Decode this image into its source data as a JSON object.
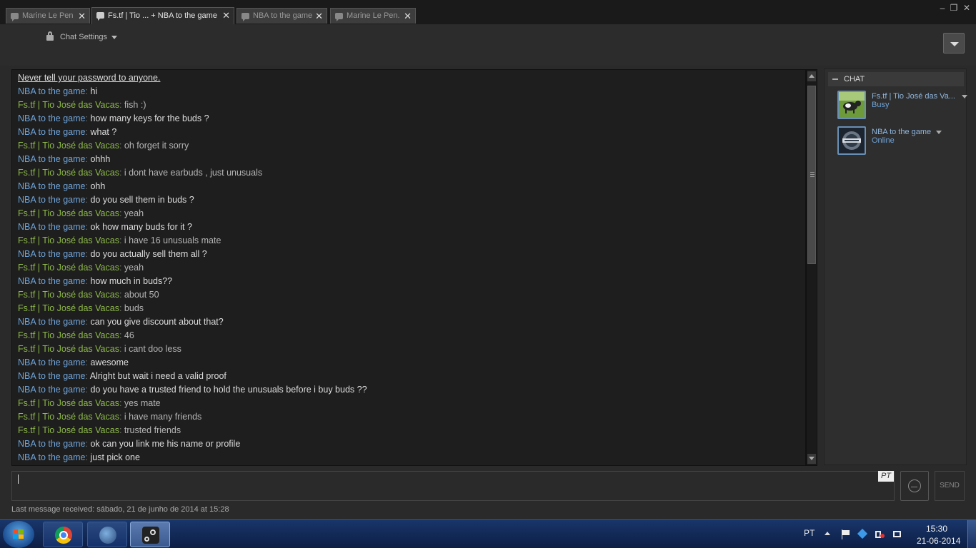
{
  "tabs": [
    {
      "label": "Marine Le Pen",
      "close": "✕"
    },
    {
      "label": "Fs.tf | Tio ... + NBA to the game",
      "close": "✕"
    },
    {
      "label": "NBA to the game",
      "close": "✕"
    },
    {
      "label": "Marine Le Pen.",
      "close": "✕"
    }
  ],
  "window_controls": {
    "minimize": "‒",
    "maximize": "❐",
    "close": "✕"
  },
  "header": {
    "chat_settings": "Chat Settings"
  },
  "chat": {
    "warning": "Never tell your password to anyone.",
    "messages": [
      {
        "sender": "NBA to the game",
        "text": "hi"
      },
      {
        "sender": "Fs.tf | Tio José das Vacas",
        "text": "fish :)"
      },
      {
        "sender": "NBA to the game",
        "text": "how many keys for the buds ?"
      },
      {
        "sender": "NBA to the game",
        "text": "what ?"
      },
      {
        "sender": "Fs.tf | Tio José das Vacas",
        "text": "oh forget it sorry"
      },
      {
        "sender": "NBA to the game",
        "text": "ohhh"
      },
      {
        "sender": "Fs.tf | Tio José das Vacas",
        "text": "i dont have earbuds , just unusuals"
      },
      {
        "sender": "NBA to the game",
        "text": "ohh"
      },
      {
        "sender": "NBA to the game",
        "text": "do you sell them in buds ?"
      },
      {
        "sender": "Fs.tf | Tio José das Vacas",
        "text": "yeah"
      },
      {
        "sender": "NBA to the game",
        "text": "ok how many buds for it ?"
      },
      {
        "sender": "Fs.tf | Tio José das Vacas",
        "text": "i have 16 unusuals mate"
      },
      {
        "sender": "NBA to the game",
        "text": "do you actually sell them all ?"
      },
      {
        "sender": "Fs.tf | Tio José das Vacas",
        "text": "yeah"
      },
      {
        "sender": "NBA to the game",
        "text": "how much in buds??"
      },
      {
        "sender": "Fs.tf | Tio José das Vacas",
        "text": "about 50"
      },
      {
        "sender": "Fs.tf | Tio José das Vacas",
        "text": "buds"
      },
      {
        "sender": "NBA to the game",
        "text": "can you give discount about that?"
      },
      {
        "sender": "Fs.tf | Tio José das Vacas",
        "text": "46"
      },
      {
        "sender": "Fs.tf | Tio José das Vacas",
        "text": "i cant doo less"
      },
      {
        "sender": "NBA to the game",
        "text": "awesome"
      },
      {
        "sender": "NBA to the game",
        "text": "Alright but wait i need a valid proof"
      },
      {
        "sender": "NBA to the game",
        "text": "do you have a trusted friend to hold the unusuals before i buy buds ??"
      },
      {
        "sender": "Fs.tf | Tio José das Vacas",
        "text": "yes mate"
      },
      {
        "sender": "Fs.tf | Tio José das Vacas",
        "text": "i have many friends"
      },
      {
        "sender": "Fs.tf | Tio José das Vacas",
        "text": "trusted friends"
      },
      {
        "sender": "NBA to the game",
        "text": "ok can you  link me his name or profile"
      },
      {
        "sender": "NBA to the game",
        "text": "just pick one"
      }
    ]
  },
  "members": {
    "section_title": "CHAT",
    "list": [
      {
        "name": "Fs.tf | Tio José das Va...",
        "status": "Busy"
      },
      {
        "name": "NBA to the game",
        "status": "Online"
      }
    ]
  },
  "input": {
    "lang_badge": "PT",
    "send_label": "SEND"
  },
  "footer": {
    "last_message": "Last message received: sábado, 21 de junho de 2014 at 15:28"
  },
  "taskbar": {
    "lang": "PT",
    "time": "15:30",
    "date": "21-06-2014"
  },
  "colors": {
    "blue_sender": "#6fa3d8",
    "green_sender": "#8db949",
    "background": "#2a2a2a"
  }
}
